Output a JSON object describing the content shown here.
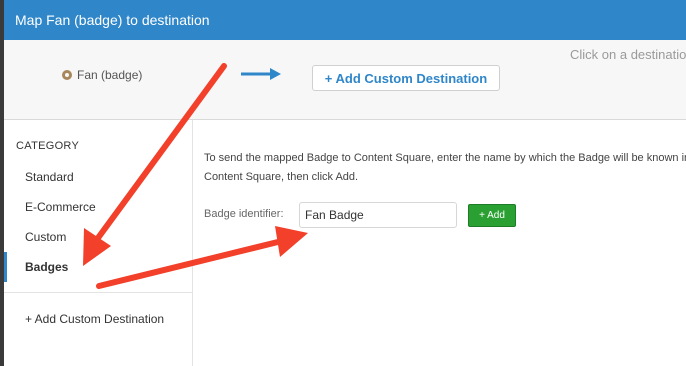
{
  "header": {
    "title": "Map Fan (badge) to destination"
  },
  "mapping": {
    "hint": "Click on a destination",
    "source_label": "Fan (badge)",
    "source_icon": "badge-icon",
    "arrow_icon": "arrow-right-icon",
    "add_destination_button": "+ Add Custom Destination"
  },
  "sidebar": {
    "heading": "CATEGORY",
    "items": [
      {
        "label": "Standard",
        "active": false
      },
      {
        "label": "E-Commerce",
        "active": false
      },
      {
        "label": "Custom",
        "active": false
      },
      {
        "label": "Badges",
        "active": true
      }
    ],
    "add_custom": "+ Add Custom Destination"
  },
  "content": {
    "description": "To send the mapped Badge to Content Square, enter the name by which the Badge will be known in Content Square, then click Add.",
    "field_label": "Badge identifier:",
    "field_value": "Fan Badge",
    "add_button": "+ Add"
  },
  "colors": {
    "header": "#2f86c9",
    "accent": "#2f86c9",
    "add_button": "#2aa032",
    "annotation_arrows": "#f2402a"
  }
}
